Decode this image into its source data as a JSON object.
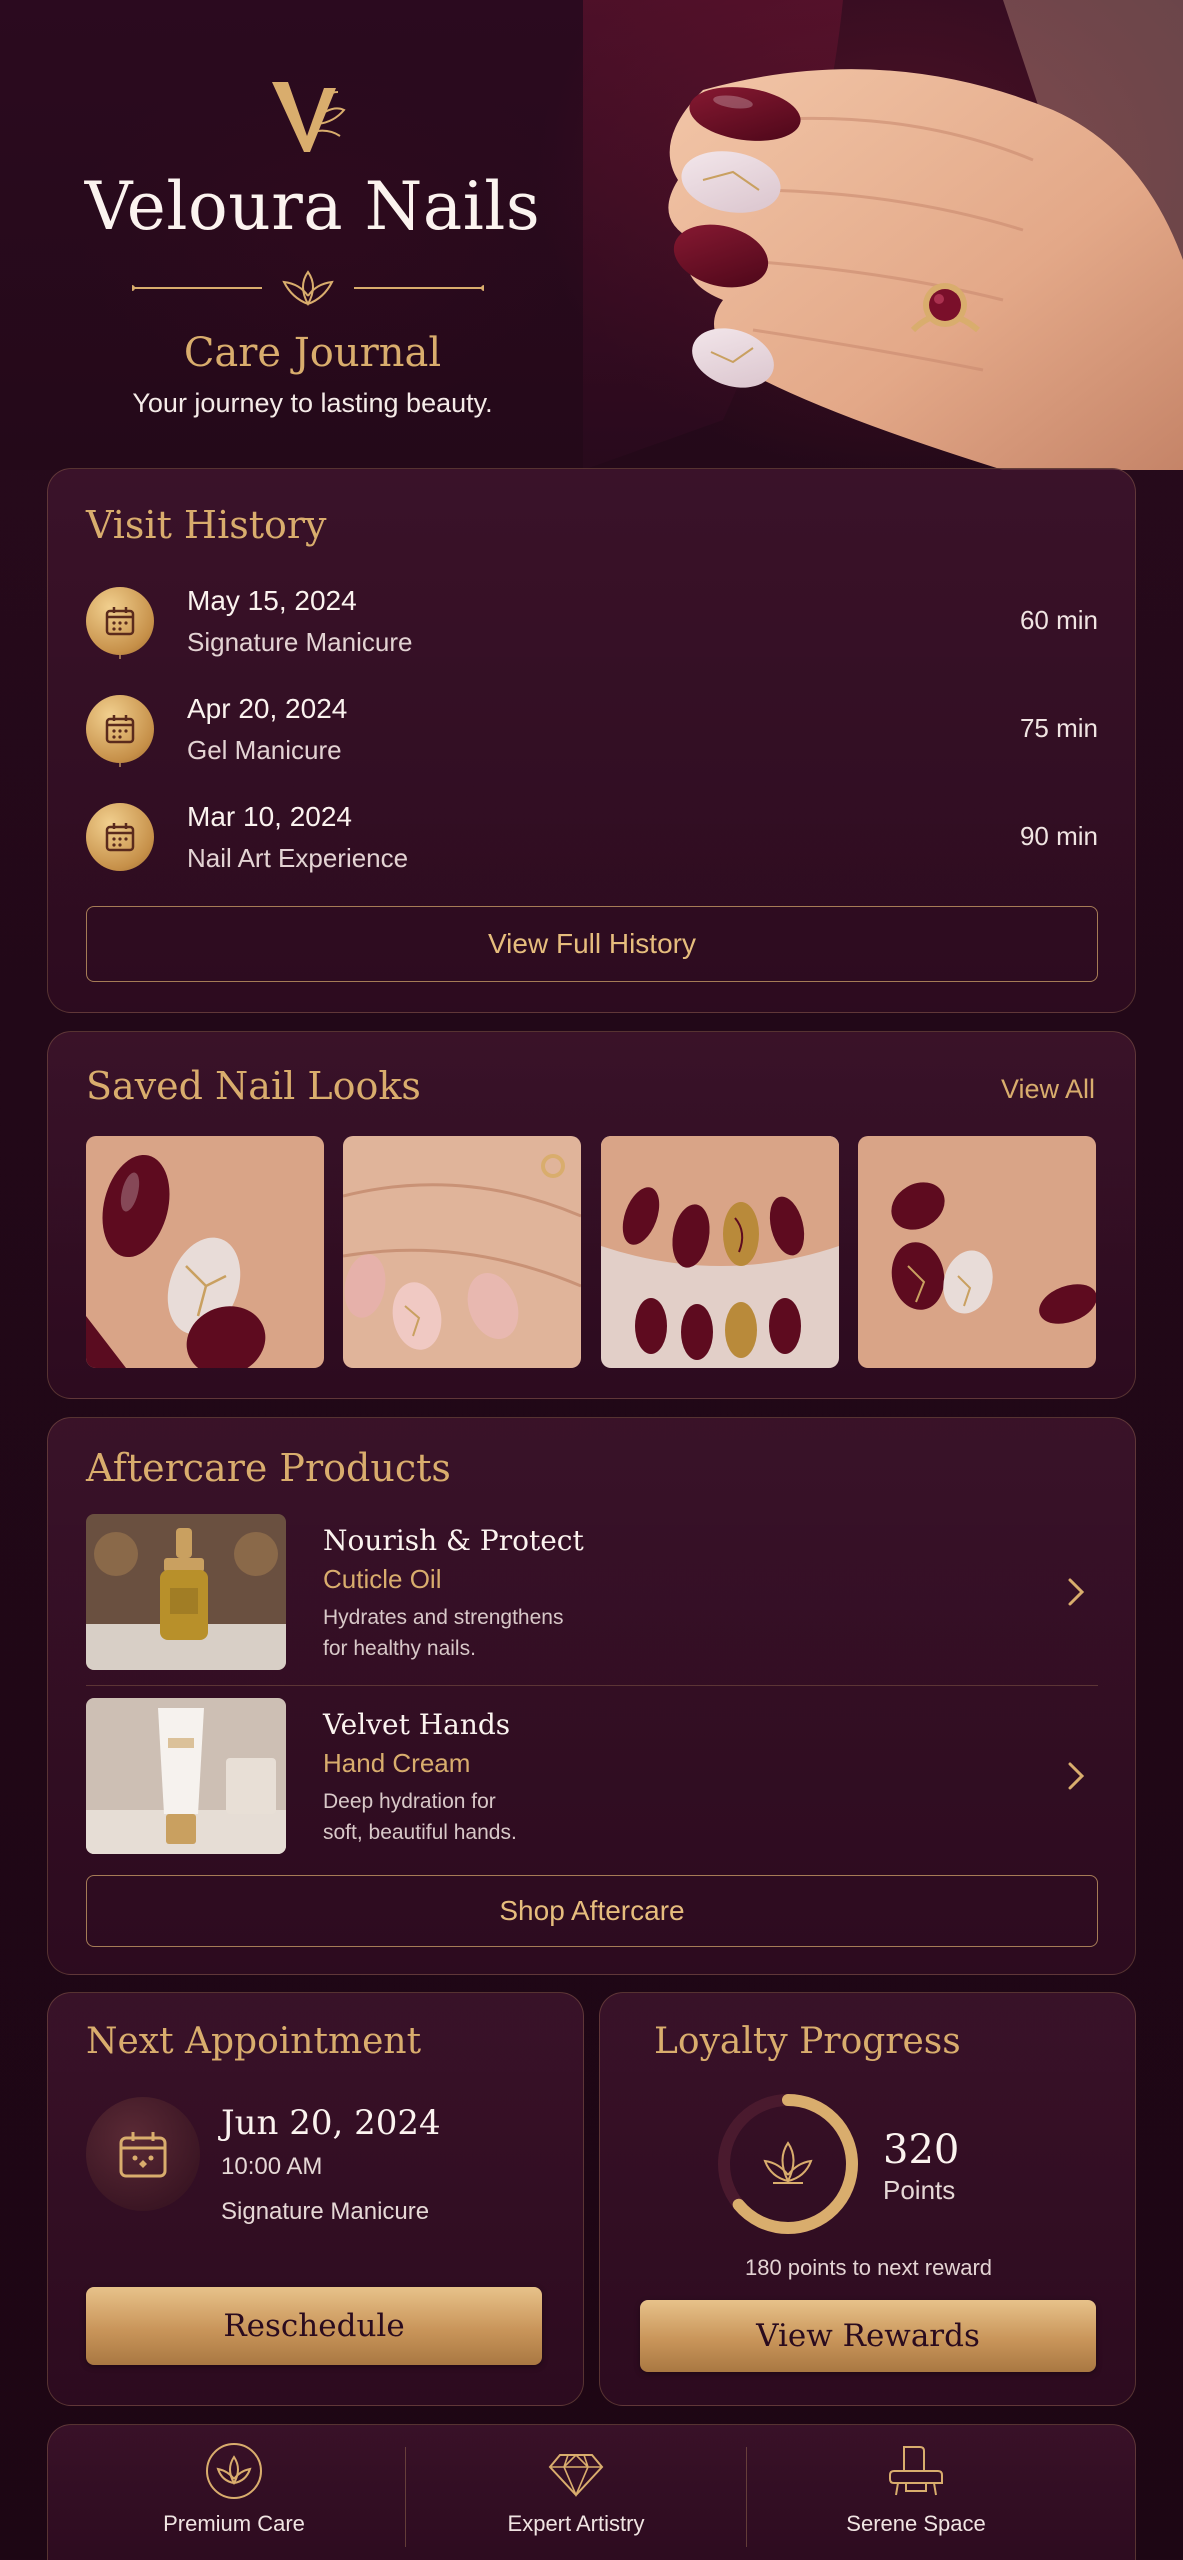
{
  "brand": {
    "name": "Veloura Nails",
    "journal_title": "Care Journal",
    "tagline": "Your journey to lasting beauty."
  },
  "visit_history": {
    "title": "Visit History",
    "visits": [
      {
        "date": "May 15, 2024",
        "service": "Signature Manicure",
        "duration": "60 min"
      },
      {
        "date": "Apr 20, 2024",
        "service": "Gel Manicure",
        "duration": "75 min"
      },
      {
        "date": "Mar 10, 2024",
        "service": "Nail Art Experience",
        "duration": "90 min"
      }
    ],
    "button_label": "View Full History"
  },
  "saved_looks": {
    "title": "Saved Nail Looks",
    "view_all_label": "View All"
  },
  "aftercare": {
    "title": "Aftercare Products",
    "products": [
      {
        "name": "Nourish & Protect",
        "type": "Cuticle Oil",
        "desc_line1": "Hydrates and strengthens",
        "desc_line2": "for healthy nails."
      },
      {
        "name": "Velvet Hands",
        "type": "Hand Cream",
        "desc_line1": "Deep hydration for",
        "desc_line2": "soft, beautiful hands."
      }
    ],
    "button_label": "Shop Aftercare"
  },
  "next_appointment": {
    "title": "Next Appointment",
    "date": "Jun 20, 2024",
    "time": "10:00 AM",
    "service": "Signature Manicure",
    "button_label": "Reschedule"
  },
  "loyalty": {
    "title": "Loyalty Progress",
    "points": "320",
    "points_label": "Points",
    "progress_fraction": 0.64,
    "next_reward_text": "180 points to next reward",
    "button_label": "View Rewards"
  },
  "features": [
    {
      "label": "Premium Care",
      "icon": "lotus-icon"
    },
    {
      "label": "Expert Artistry",
      "icon": "diamond-icon"
    },
    {
      "label": "Serene Space",
      "icon": "chair-icon"
    }
  ],
  "colors": {
    "background": "#240919",
    "accent_gold": "#d9ad6d",
    "burgundy_polish": "#5e0b1f"
  }
}
